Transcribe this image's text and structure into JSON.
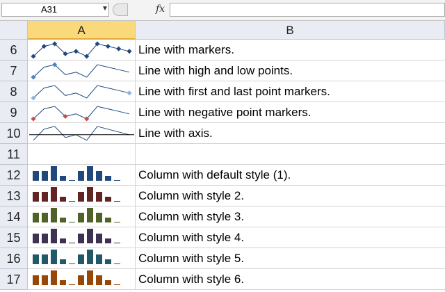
{
  "formula_bar": {
    "name_box": "A31",
    "fx_label": "fx",
    "formula": ""
  },
  "columns": [
    "A",
    "B"
  ],
  "rows": [
    {
      "num": "6",
      "text": "Line with markers."
    },
    {
      "num": "7",
      "text": "Line with high and low points."
    },
    {
      "num": "8",
      "text": "Line with first and last point markers."
    },
    {
      "num": "9",
      "text": "Line with negative point markers."
    },
    {
      "num": "10",
      "text": "Line with axis."
    },
    {
      "num": "11",
      "text": ""
    },
    {
      "num": "12",
      "text": "Column with default style (1)."
    },
    {
      "num": "13",
      "text": "Column with style 2."
    },
    {
      "num": "14",
      "text": "Column with style 3."
    },
    {
      "num": "15",
      "text": "Column with style 4."
    },
    {
      "num": "16",
      "text": "Column with style 5."
    },
    {
      "num": "17",
      "text": "Column with style 6."
    }
  ],
  "sparkline_values": [
    -2,
    2,
    3,
    -1,
    0,
    -2,
    3,
    2,
    1,
    0
  ],
  "line_color": "#1f497d",
  "marker_colors": {
    "markers": "#1f497d",
    "high_low": "#4f81bd",
    "first_last": "#8db3e2",
    "negative": "#c0504d"
  },
  "column_colors": [
    "#1f497d",
    "#632523",
    "#4f6228",
    "#3f3151",
    "#215968",
    "#974706"
  ]
}
